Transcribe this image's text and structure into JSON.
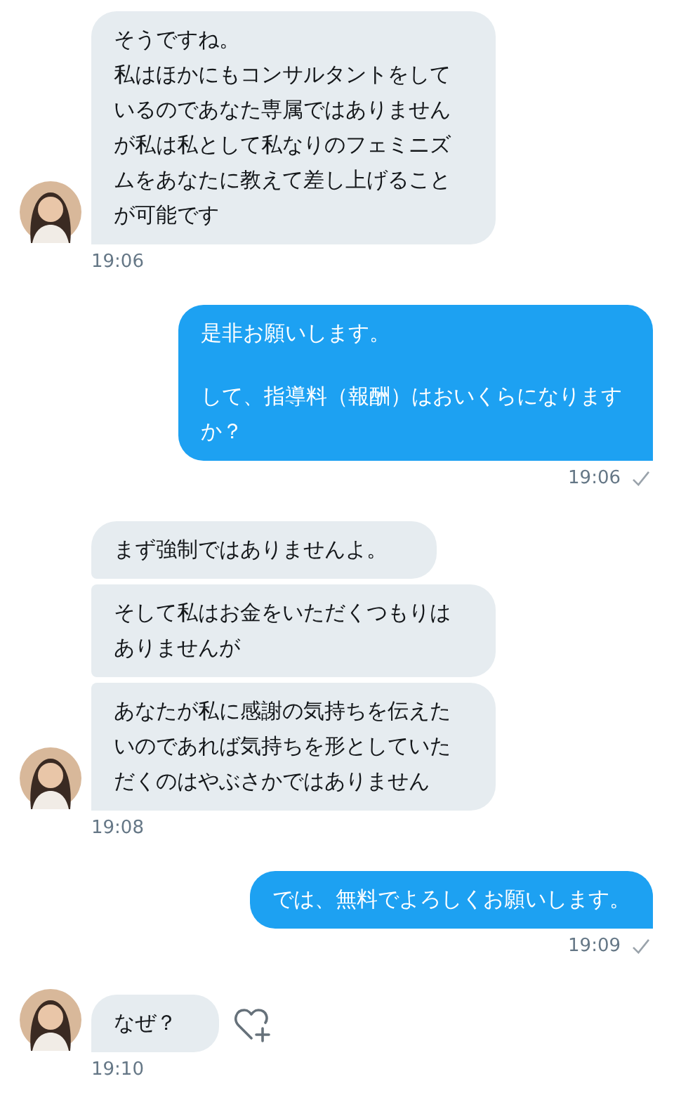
{
  "groups": [
    {
      "kind": "incoming",
      "messages": [
        {
          "paragraphs": [
            "そうですね。",
            "私はほかにもコンサルタントをしているのであなた専属ではありませんが私は私として私なりのフェミニズムをあなたに教えて差し上げることが可能です"
          ],
          "react_button": false
        }
      ],
      "time": "19:06"
    },
    {
      "kind": "outgoing",
      "messages": [
        {
          "paragraphs": [
            "是非お願いします。",
            "して、指導料（報酬）はおいくらになりますか？"
          ],
          "react_button": false
        }
      ],
      "time": "19:06",
      "sent": true
    },
    {
      "kind": "incoming",
      "messages": [
        {
          "paragraphs": [
            "まず強制ではありませんよ。"
          ],
          "react_button": false
        },
        {
          "paragraphs": [
            "そして私はお金をいただくつもりはありませんが"
          ],
          "react_button": false
        },
        {
          "paragraphs": [
            "あなたが私に感謝の気持ちを伝えたいのであれば気持ちを形としていただくのはやぶさかではありません"
          ],
          "react_button": false
        }
      ],
      "time": "19:08"
    },
    {
      "kind": "outgoing",
      "messages": [
        {
          "paragraphs": [
            "では、無料でよろしくお願いします。"
          ],
          "react_button": false
        }
      ],
      "time": "19:09",
      "sent": true
    },
    {
      "kind": "incoming",
      "messages": [
        {
          "paragraphs": [
            "なぜ？"
          ],
          "react_button": true
        }
      ],
      "time": "19:10"
    }
  ]
}
